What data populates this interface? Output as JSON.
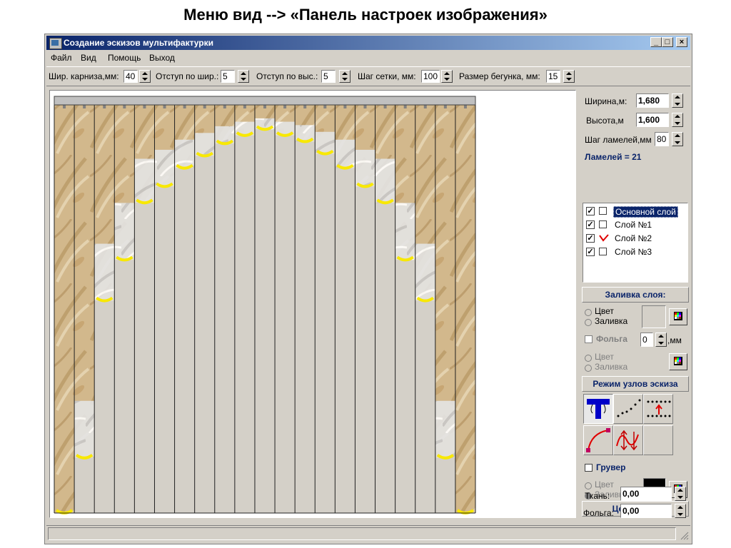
{
  "slide": {
    "title": "Меню вид --> «Панель настроек изображения»"
  },
  "window": {
    "title": "Создание эскизов мультифактурки",
    "buttons": [
      "_",
      "□",
      "×"
    ]
  },
  "menu": [
    "Файл",
    "Вид",
    "Помощь",
    "Выход"
  ],
  "toolbar": {
    "cornice_width_label": "Шир. карниза,мм:",
    "cornice_width_value": "40",
    "indent_w_label": "Отступ по шир.:",
    "indent_w_value": "5",
    "indent_h_label": "Отступ по выс.:",
    "indent_h_value": "5",
    "grid_step_label": "Шаг сетки, мм:",
    "grid_step_value": "100",
    "slider_size_label": "Размер бегунка, мм:",
    "slider_size_value": "15"
  },
  "panel": {
    "width_label": "Ширина,м:",
    "width_value": "1,680",
    "height_label": "Высота,м",
    "height_value": "1,600",
    "slat_step_label": "Шаг ламелей,мм",
    "slat_step_value": "80",
    "slats_count": "Ламелей = 21",
    "layers": [
      {
        "name": "Основной слой",
        "checked": true,
        "selected": true
      },
      {
        "name": "Слой №1",
        "checked": true,
        "selected": false
      },
      {
        "name": "Слой №2",
        "checked": true,
        "selected": false
      },
      {
        "name": "Слой №3",
        "checked": true,
        "selected": false
      }
    ],
    "fill_header": "Заливка слоя:",
    "color_label": "Цвет",
    "fill_label": "Заливка",
    "foil_label": "Фольга",
    "foil_value": "0",
    "foil_unit": ",мм",
    "color2_label": "Цвет",
    "fill2_label": "Заливка",
    "node_mode_header": "Режим узлов эскиза",
    "gruver_label": "Грувер",
    "color3_label": "Цвет",
    "fill3_label": "Заливка",
    "prices_header": "Цены слоя",
    "fabric_label": "Ткань:",
    "fabric_value": "0,00",
    "foil_price_label": "Фольга:",
    "foil_price_value": "0,00"
  },
  "colors": {
    "titlebar": "#0a246a",
    "fabric_beige": "#c8a878",
    "fabric_light": "#e2e2e2",
    "slat_gray": "#d4d0c8",
    "yellow_edge": "#f8e800",
    "selection": "#0a246a"
  },
  "slats": {
    "count": 21,
    "bottom_levels": [
      1.0,
      0.865,
      0.48,
      0.38,
      0.24,
      0.2,
      0.155,
      0.125,
      0.095,
      0.075,
      0.06,
      0.075,
      0.09,
      0.12,
      0.155,
      0.2,
      0.24,
      0.38,
      0.48,
      0.865,
      1.0
    ]
  }
}
